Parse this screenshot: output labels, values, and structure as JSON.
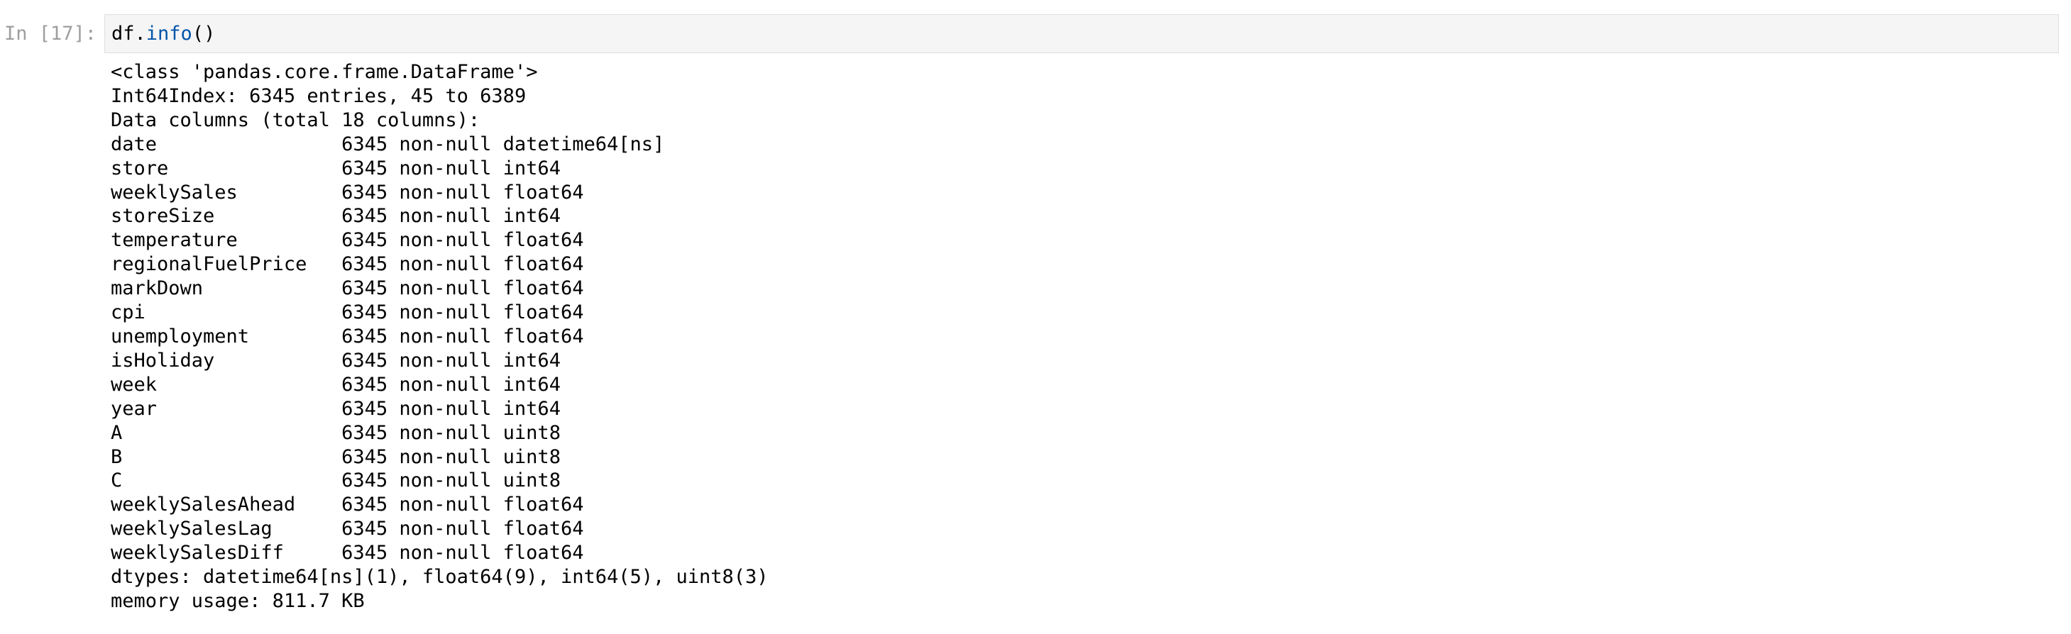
{
  "cell": {
    "prompt": "In [17]:",
    "code": {
      "object": "df.",
      "method": "info",
      "call": "()"
    },
    "colors": {
      "method": "#0055aa",
      "prompt": "#9e9e9e",
      "input_bg": "#f5f5f5"
    }
  },
  "output": {
    "header": [
      "<class 'pandas.core.frame.DataFrame'>",
      "Int64Index: 6345 entries, 45 to 6389",
      "Data columns (total 18 columns):"
    ],
    "columns": [
      {
        "name": "date",
        "info": "6345 non-null datetime64[ns]"
      },
      {
        "name": "store",
        "info": "6345 non-null int64"
      },
      {
        "name": "weeklySales",
        "info": "6345 non-null float64"
      },
      {
        "name": "storeSize",
        "info": "6345 non-null int64"
      },
      {
        "name": "temperature",
        "info": "6345 non-null float64"
      },
      {
        "name": "regionalFuelPrice",
        "info": "6345 non-null float64"
      },
      {
        "name": "markDown",
        "info": "6345 non-null float64"
      },
      {
        "name": "cpi",
        "info": "6345 non-null float64"
      },
      {
        "name": "unemployment",
        "info": "6345 non-null float64"
      },
      {
        "name": "isHoliday",
        "info": "6345 non-null int64"
      },
      {
        "name": "week",
        "info": "6345 non-null int64"
      },
      {
        "name": "year",
        "info": "6345 non-null int64"
      },
      {
        "name": "A",
        "info": "6345 non-null uint8"
      },
      {
        "name": "B",
        "info": "6345 non-null uint8"
      },
      {
        "name": "C",
        "info": "6345 non-null uint8"
      },
      {
        "name": "weeklySalesAhead",
        "info": "6345 non-null float64"
      },
      {
        "name": "weeklySalesLag",
        "info": "6345 non-null float64"
      },
      {
        "name": "weeklySalesDiff",
        "info": "6345 non-null float64"
      }
    ],
    "footer": [
      "dtypes: datetime64[ns](1), float64(9), int64(5), uint8(3)",
      "memory usage: 811.7 KB"
    ]
  }
}
